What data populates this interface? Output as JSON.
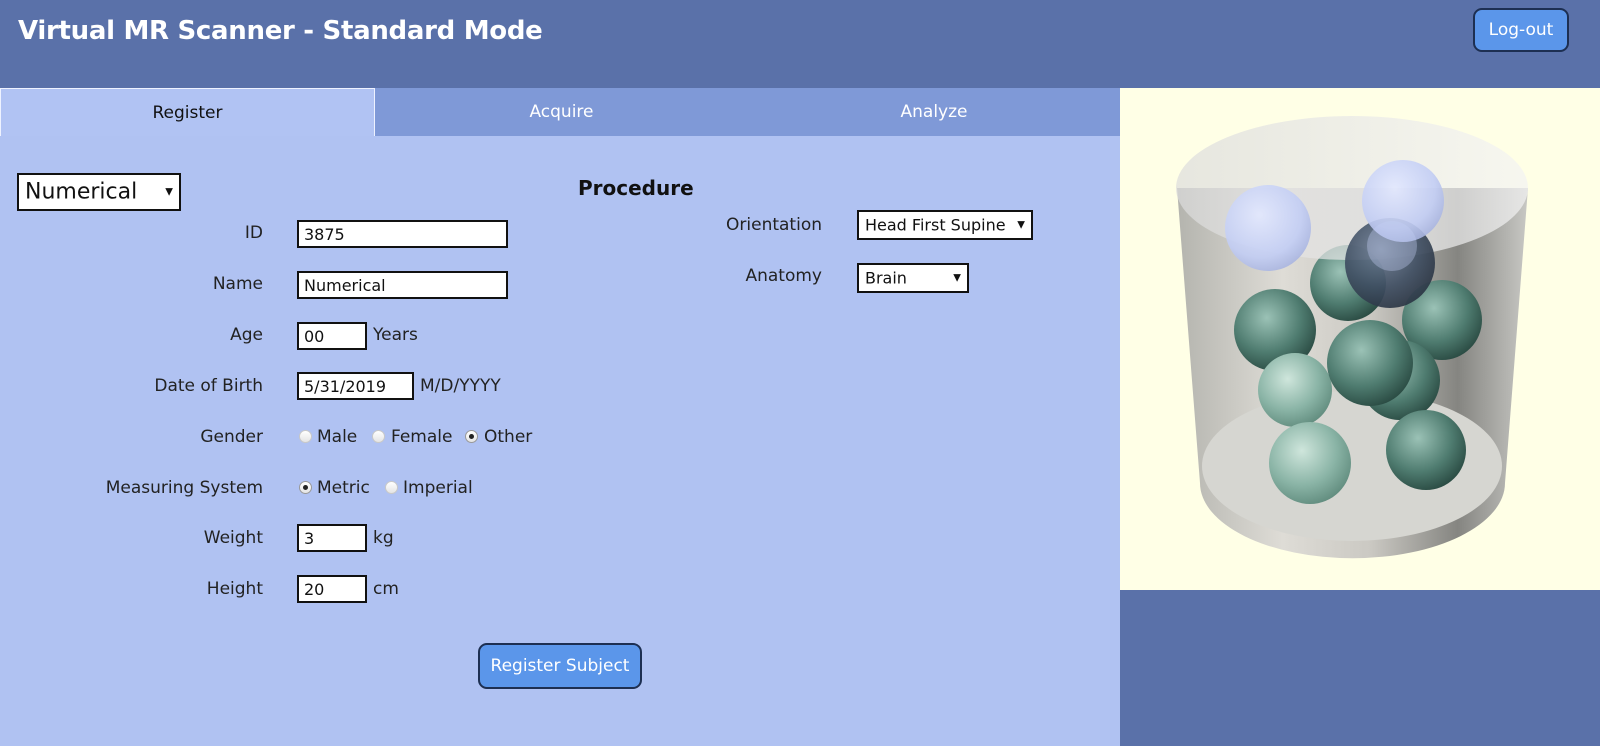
{
  "header": {
    "title": "Virtual MR Scanner - Standard Mode",
    "logout_label": "Log-out"
  },
  "tabs": [
    {
      "label": "Register",
      "active": true
    },
    {
      "label": "Acquire",
      "active": false
    },
    {
      "label": "Analyze",
      "active": false
    }
  ],
  "register": {
    "phantom_select": "Numerical",
    "fields": {
      "id": {
        "label": "ID",
        "value": "3875"
      },
      "name": {
        "label": "Name",
        "value": "Numerical"
      },
      "age": {
        "label": "Age",
        "value": "00",
        "unit": "Years"
      },
      "dob": {
        "label": "Date of Birth",
        "value": "5/31/2019",
        "unit": "M/D/YYYY"
      },
      "gender": {
        "label": "Gender",
        "options": [
          "Male",
          "Female",
          "Other"
        ],
        "selected": "Other"
      },
      "measuring_system": {
        "label": "Measuring System",
        "options": [
          "Metric",
          "Imperial"
        ],
        "selected": "Metric"
      },
      "weight": {
        "label": "Weight",
        "value": "3",
        "unit": "kg"
      },
      "height": {
        "label": "Height",
        "value": "20",
        "unit": "cm"
      }
    },
    "submit_label": "Register Subject"
  },
  "procedure": {
    "title": "Procedure",
    "orientation": {
      "label": "Orientation",
      "value": "Head First Supine"
    },
    "anatomy": {
      "label": "Anatomy",
      "value": "Brain"
    }
  },
  "colors": {
    "header_bg": "#5a71a9",
    "tab_bar_bg": "#7f99d7",
    "panel_bg": "#b0c2f2",
    "button_bg": "#5b96ea",
    "viewer_bg": "#ffffe6"
  }
}
